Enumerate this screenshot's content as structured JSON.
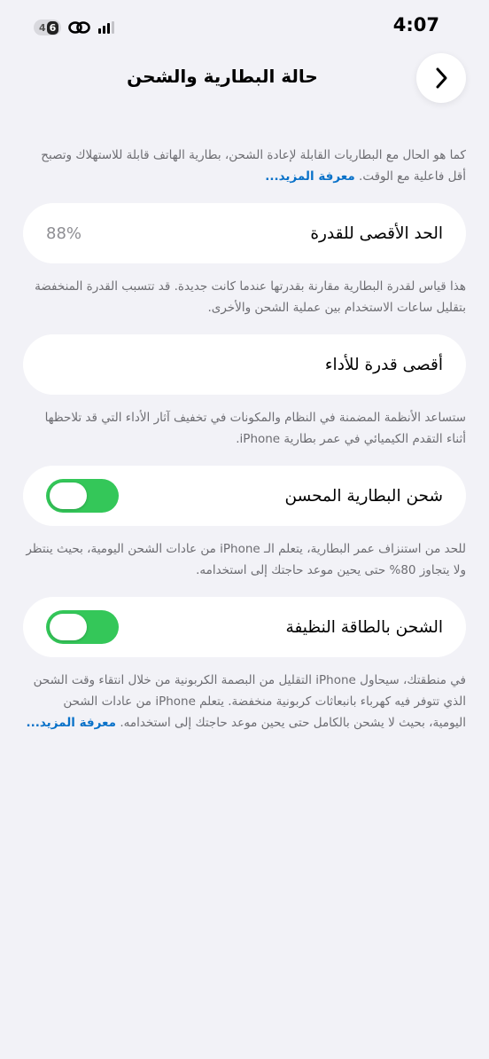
{
  "status_bar": {
    "time": "4:07",
    "network": "4",
    "network_badge": "6",
    "icons": [
      "network-badge-icon",
      "link-icon",
      "signal-icon"
    ]
  },
  "nav": {
    "title": "حالة البطارية والشحن",
    "back_icon": "chevron-right-icon"
  },
  "intro": {
    "text": "كما هو الحال مع البطاريات القابلة لإعادة الشحن، بطارية الهاتف قابلة للاستهلاك وتصبح أقل فاعلية مع الوقت.",
    "link": "معرفة المزيد..."
  },
  "max_capacity": {
    "label": "الحد الأقصى للقدرة",
    "value": "88%",
    "footnote": "هذا قياس لقدرة البطارية مقارنة بقدرتها عندما كانت جديدة. قد تتسبب القدرة المنخفضة بتقليل ساعات الاستخدام بين عملية الشحن والأخرى."
  },
  "peak_performance": {
    "label": "أقصى قدرة للأداء",
    "footnote": "ستساعد الأنظمة المضمنة في النظام والمكونات في تخفيف آثار الأداء التي قد تلاحظها أثناء التقدم الكيميائي في عمر بطارية iPhone."
  },
  "optimized_charging": {
    "label": "شحن البطارية المحسن",
    "enabled": true,
    "footnote": "للحد من استنزاف عمر البطارية، يتعلم الـ iPhone من عادات الشحن اليومية، بحيث ينتظر ولا يتجاوز 80% حتى يحين موعد حاجتك إلى استخدامه."
  },
  "clean_energy": {
    "label": "الشحن بالطاقة النظيفة",
    "enabled": true,
    "footnote": "في منطقتك، سيحاول iPhone التقليل من البصمة الكربونية من خلال انتقاء وقت الشحن الذي تتوفر فيه كهرباء بانبعاثات كربونية منخفضة. يتعلم iPhone من عادات الشحن اليومية، بحيث لا يشحن بالكامل حتى يحين موعد حاجتك إلى استخدامه.",
    "link": "معرفة المزيد..."
  },
  "colors": {
    "background": "#f2f2f7",
    "toggle_on": "#34c759",
    "link": "#0a72c9"
  }
}
